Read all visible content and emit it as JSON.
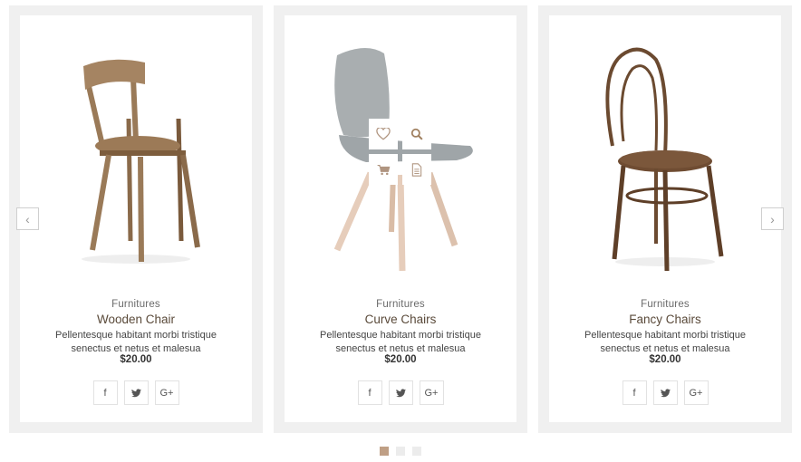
{
  "products": [
    {
      "category": "Furnitures",
      "title": "Wooden Chair",
      "description": "Pellentesque habitant morbi tristique senectus et netus et malesua",
      "price": "$20.00",
      "image_icon": "wooden-chair-image"
    },
    {
      "category": "Furnitures",
      "title": "Curve Chairs",
      "description": "Pellentesque habitant morbi tristique senectus et netus et malesua",
      "price": "$20.00",
      "image_icon": "curve-chair-image"
    },
    {
      "category": "Furnitures",
      "title": "Fancy Chairs",
      "description": "Pellentesque habitant morbi tristique senectus et netus et malesua",
      "price": "$20.00",
      "image_icon": "fancy-chair-image"
    }
  ],
  "social": {
    "facebook": "f",
    "twitter": "twitter-icon",
    "google_plus": "G+"
  },
  "overlay_actions": [
    "heart-icon",
    "magnifier-icon",
    "cart-icon",
    "document-icon"
  ],
  "carousel": {
    "prev": "‹",
    "next": "›",
    "dots": 3,
    "active_dot": 1
  },
  "colors": {
    "accent": "#bf9f85",
    "card_border": "#f0f0f0",
    "title": "#5a4a3a"
  }
}
